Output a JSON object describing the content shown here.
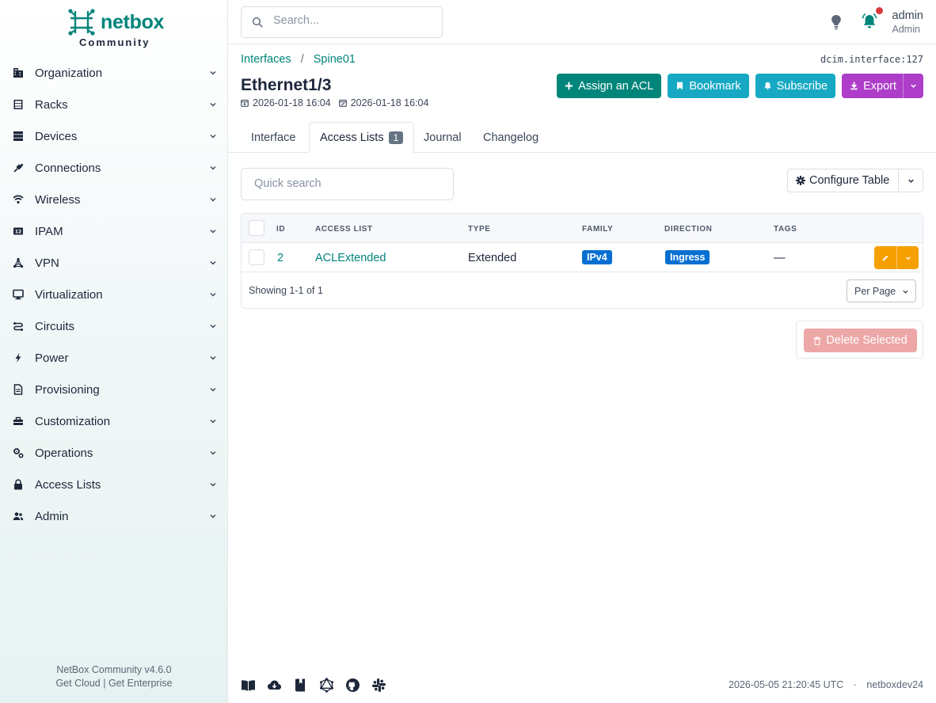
{
  "brand": {
    "name": "netbox",
    "sub": "Community",
    "color": "#00857a"
  },
  "sidebar": {
    "items": [
      {
        "label": "Organization",
        "icon": "domain-icon"
      },
      {
        "label": "Racks",
        "icon": "rack-icon"
      },
      {
        "label": "Devices",
        "icon": "server-icon"
      },
      {
        "label": "Connections",
        "icon": "ethernet-icon"
      },
      {
        "label": "Wireless",
        "icon": "wifi-icon"
      },
      {
        "label": "IPAM",
        "icon": "counter-icon"
      },
      {
        "label": "VPN",
        "icon": "tunnel-icon"
      },
      {
        "label": "Virtualization",
        "icon": "monitor-icon"
      },
      {
        "label": "Circuits",
        "icon": "transit-icon"
      },
      {
        "label": "Power",
        "icon": "flash-icon"
      },
      {
        "label": "Provisioning",
        "icon": "file-document-icon"
      },
      {
        "label": "Customization",
        "icon": "toolbox-icon"
      },
      {
        "label": "Operations",
        "icon": "cogs-icon"
      },
      {
        "label": "Access Lists",
        "icon": "lock-icon"
      },
      {
        "label": "Admin",
        "icon": "account-multiple-icon"
      }
    ],
    "footer": {
      "version": "NetBox Community v4.6.0",
      "cloud": "Get Cloud",
      "sep": "|",
      "enterprise": "Get Enterprise"
    }
  },
  "topbar": {
    "search_placeholder": "Search...",
    "user": {
      "name": "admin",
      "role": "Admin"
    }
  },
  "header": {
    "breadcrumb": [
      "Interfaces",
      "Spine01"
    ],
    "breadcrumb_sep": "/",
    "object_id": "dcim.interface:127",
    "title": "Ethernet1/3",
    "created": "2026-01-18 16:04",
    "updated": "2026-01-18 16:04",
    "actions": {
      "assign_acl": "Assign an ACL",
      "bookmark": "Bookmark",
      "subscribe": "Subscribe",
      "export": "Export"
    }
  },
  "tabs": [
    {
      "label": "Interface"
    },
    {
      "label": "Access Lists",
      "count": "1",
      "active": true
    },
    {
      "label": "Journal"
    },
    {
      "label": "Changelog"
    }
  ],
  "table": {
    "quick_search_placeholder": "Quick search",
    "configure_label": "Configure Table",
    "columns": [
      "ID",
      "ACCESS LIST",
      "TYPE",
      "FAMILY",
      "DIRECTION",
      "TAGS"
    ],
    "rows": [
      {
        "id": "2",
        "access_list": "ACLExtended",
        "type": "Extended",
        "family": "IPv4",
        "direction": "Ingress",
        "tags": "—"
      }
    ],
    "showing": "Showing 1-1 of 1",
    "per_page": "Per Page",
    "delete_selected": "Delete Selected"
  },
  "footer": {
    "icons": [
      "book-open-icon",
      "cloud-download-icon",
      "book-icon",
      "graphql-icon",
      "github-icon",
      "slack-icon"
    ],
    "timestamp": "2026-05-05 21:20:45 UTC",
    "dot": "·",
    "host": "netboxdev24"
  },
  "colors": {
    "primary": "#00857a",
    "cyan": "#17a9c3",
    "purple": "#ae3ec9",
    "blue_badge": "#066fd1",
    "warning": "#f59f00",
    "danger_disabled": "#eda7a7",
    "notification_dot": "#d63939"
  }
}
